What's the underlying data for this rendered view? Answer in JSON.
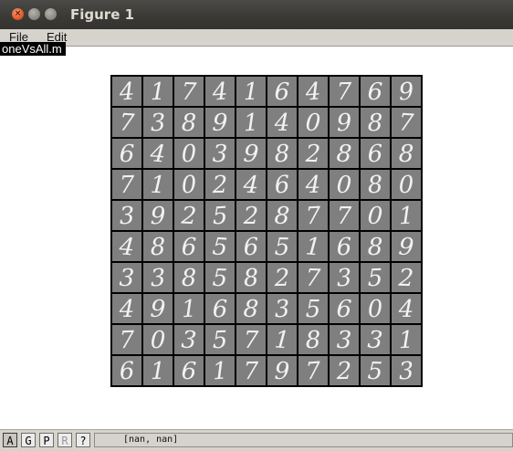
{
  "window": {
    "title": "Figure 1"
  },
  "menu": {
    "items": [
      "File",
      "Edit"
    ]
  },
  "tooltip": {
    "text": "oneVsAll.m"
  },
  "grid": {
    "rows": [
      [
        "4",
        "1",
        "7",
        "4",
        "1",
        "6",
        "4",
        "7",
        "6",
        "9"
      ],
      [
        "7",
        "3",
        "8",
        "9",
        "1",
        "4",
        "0",
        "9",
        "8",
        "7"
      ],
      [
        "6",
        "4",
        "0",
        "3",
        "9",
        "8",
        "2",
        "8",
        "6",
        "8"
      ],
      [
        "7",
        "1",
        "0",
        "2",
        "4",
        "6",
        "4",
        "0",
        "8",
        "0"
      ],
      [
        "3",
        "9",
        "2",
        "5",
        "2",
        "8",
        "7",
        "7",
        "0",
        "1"
      ],
      [
        "4",
        "8",
        "6",
        "5",
        "6",
        "5",
        "1",
        "6",
        "8",
        "9"
      ],
      [
        "3",
        "3",
        "8",
        "5",
        "8",
        "2",
        "7",
        "3",
        "5",
        "2"
      ],
      [
        "4",
        "9",
        "1",
        "6",
        "8",
        "3",
        "5",
        "6",
        "0",
        "4"
      ],
      [
        "7",
        "0",
        "3",
        "5",
        "7",
        "1",
        "8",
        "3",
        "3",
        "1"
      ],
      [
        "6",
        "1",
        "6",
        "1",
        "7",
        "9",
        "7",
        "2",
        "5",
        "3"
      ]
    ]
  },
  "toolbar": {
    "buttons": [
      "A",
      "G",
      "P",
      "R",
      "?"
    ],
    "coords": "[nan, nan]"
  }
}
